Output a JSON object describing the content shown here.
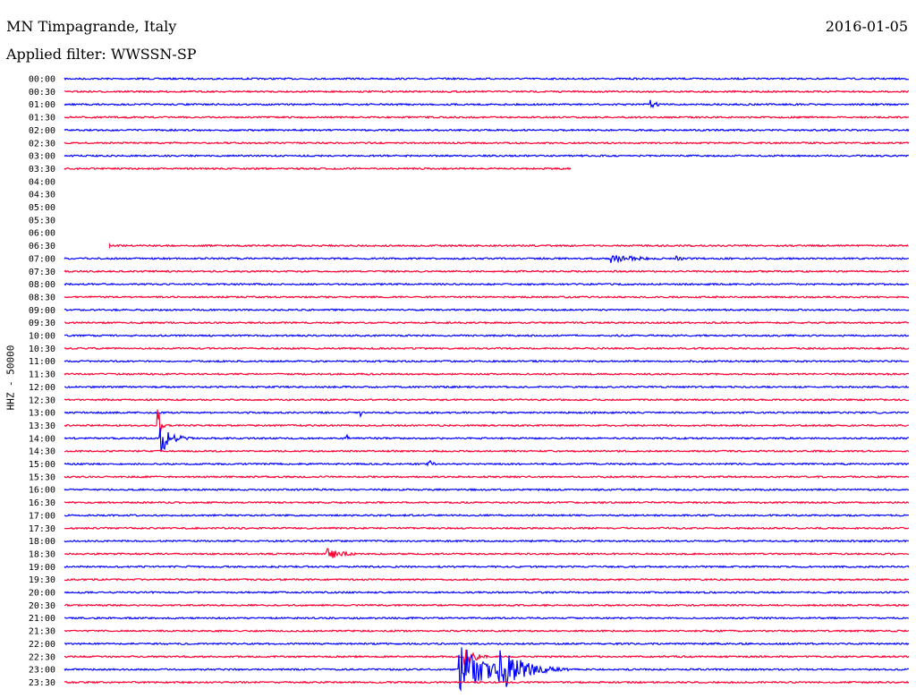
{
  "header": {
    "station": "MN Timpagrande, Italy",
    "filter": "Applied filter: WWSSN-SP",
    "date": "2016-01-05"
  },
  "chart_data": {
    "type": "line",
    "title": "MN Timpagrande, Italy",
    "subtitle": "Applied filter: WWSSN-SP",
    "ylabel": "HHZ - 50000",
    "row_labels": [
      "00:00",
      "00:30",
      "01:00",
      "01:30",
      "02:00",
      "02:30",
      "03:00",
      "03:30",
      "04:00",
      "04:30",
      "05:00",
      "05:30",
      "06:00",
      "06:30",
      "07:00",
      "07:30",
      "08:00",
      "08:30",
      "09:00",
      "09:30",
      "10:00",
      "10:30",
      "11:00",
      "11:30",
      "12:00",
      "12:30",
      "13:00",
      "13:30",
      "14:00",
      "14:30",
      "15:00",
      "15:30",
      "16:00",
      "16:30",
      "17:00",
      "17:30",
      "18:00",
      "18:30",
      "19:00",
      "19:30",
      "20:00",
      "20:30",
      "21:00",
      "21:30",
      "22:00",
      "22:30",
      "23:00",
      "23:30"
    ],
    "colors": {
      "even": "#0000ff",
      "odd": "#ff0033"
    },
    "x_range_minutes": [
      0,
      30
    ],
    "missing_rows": [
      "04:00",
      "04:30",
      "05:00",
      "05:30",
      "06:00"
    ],
    "partial_rows": [
      {
        "row": "03:30",
        "end_minute": 18
      },
      {
        "row": "06:30",
        "start_minute": 1.6
      }
    ],
    "events": [
      {
        "row": "01:00",
        "start_minute": 20.8,
        "amplitude": 6,
        "duration_minutes": 0.7
      },
      {
        "row": "02:30",
        "start_minute": 4.0,
        "amplitude": 2,
        "duration_minutes": 0.2
      },
      {
        "row": "07:00",
        "start_minute": 19.4,
        "amplitude": 5,
        "duration_minutes": 3.2
      },
      {
        "row": "07:00",
        "start_minute": 21.7,
        "amplitude": 4,
        "duration_minutes": 0.8
      },
      {
        "row": "08:30",
        "start_minute": 17.8,
        "amplitude": 2,
        "duration_minutes": 0.6
      },
      {
        "row": "13:00",
        "start_minute": 10.5,
        "amplitude": 6,
        "duration_minutes": 0.2
      },
      {
        "row": "13:30",
        "start_minute": 3.3,
        "amplitude": 30,
        "duration_minutes": 0.3
      },
      {
        "row": "14:00",
        "start_minute": 3.4,
        "amplitude": 18,
        "duration_minutes": 1.2
      },
      {
        "row": "14:00",
        "start_minute": 10.0,
        "amplitude": 5,
        "duration_minutes": 0.5
      },
      {
        "row": "15:00",
        "start_minute": 12.9,
        "amplitude": 7,
        "duration_minutes": 0.5
      },
      {
        "row": "18:30",
        "start_minute": 9.3,
        "amplitude": 7,
        "duration_minutes": 1.8
      },
      {
        "row": "22:30",
        "start_minute": 14.2,
        "amplitude": 16,
        "duration_minutes": 1.0
      },
      {
        "row": "23:00",
        "start_minute": 14.0,
        "amplitude": 30,
        "duration_minutes": 3.0
      },
      {
        "row": "23:00",
        "start_minute": 15.4,
        "amplitude": 28,
        "duration_minutes": 2.5
      }
    ]
  }
}
